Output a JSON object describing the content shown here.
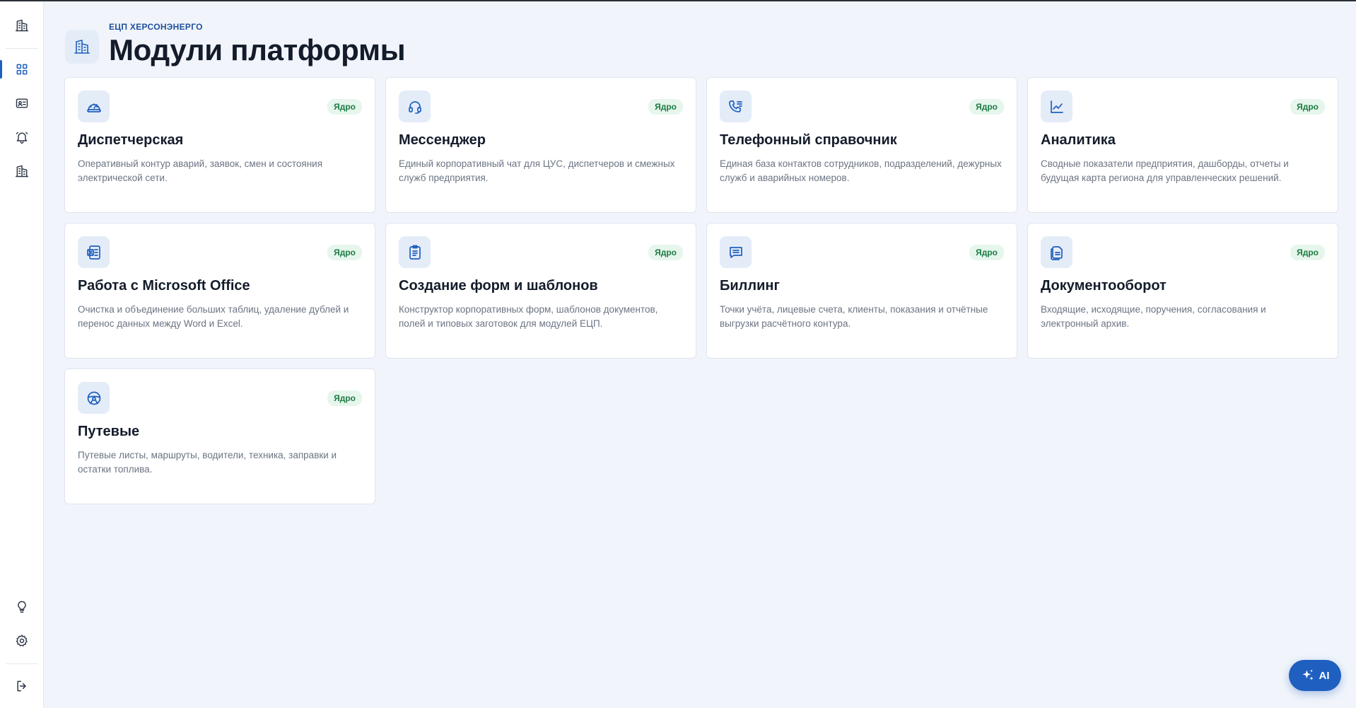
{
  "header": {
    "organization": "ЕЦП ХЕРСОНЭНЕРГО",
    "title": "Модули платформы"
  },
  "modules": [
    {
      "title": "Диспетчерская",
      "badge": "Ядро",
      "description": "Оперативный контур аварий, заявок, смен и состояния электрической сети.",
      "icon": "speedometer-icon"
    },
    {
      "title": "Мессенджер",
      "badge": "Ядро",
      "description": "Единый корпоративный чат для ЦУС, диспетчеров и смежных служб предприятия.",
      "icon": "headset-icon"
    },
    {
      "title": "Телефонный справочник",
      "badge": "Ядро",
      "description": "Единая база контактов сотрудников, подразделений, дежурных служб и аварийных номеров.",
      "icon": "phone-list-icon"
    },
    {
      "title": "Аналитика",
      "badge": "Ядро",
      "description": "Сводные показатели предприятия, дашборды, отчеты и будущая карта региона для управленческих решений.",
      "icon": "chart-line-icon"
    },
    {
      "title": "Работа с Microsoft Office",
      "badge": "Ядро",
      "description": "Очистка и объединение больших таблиц, удаление дублей и перенос данных между Word и Excel.",
      "icon": "excel-file-icon"
    },
    {
      "title": "Создание форм и шаблонов",
      "badge": "Ядро",
      "description": "Конструктор корпоративных форм, шаблонов документов, полей и типовых заготовок для модулей ЕЦП.",
      "icon": "clipboard-icon"
    },
    {
      "title": "Биллинг",
      "badge": "Ядро",
      "description": "Точки учёта, лицевые счета, клиенты, показания и отчётные выгрузки расчётного контура.",
      "icon": "receipt-icon"
    },
    {
      "title": "Документооборот",
      "badge": "Ядро",
      "description": "Входящие, исходящие, поручения, согласования и электронный архив.",
      "icon": "documents-icon"
    },
    {
      "title": "Путевые",
      "badge": "Ядро",
      "description": "Путевые листы, маршруты, водители, техника, заправки и остатки топлива.",
      "icon": "steering-wheel-icon"
    }
  ],
  "ai_button": {
    "label": "AI"
  },
  "colors": {
    "accent": "#1f5fbf",
    "badge_bg": "#e6f6ec",
    "badge_text": "#1e7b45"
  }
}
